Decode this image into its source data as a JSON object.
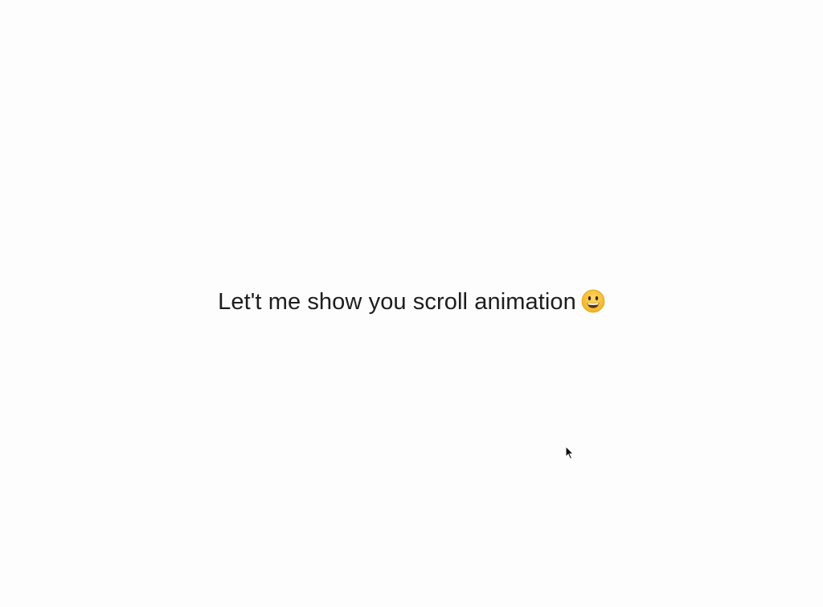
{
  "main": {
    "headline_text": "Let't me show you scroll animation",
    "emoji_icon": "grinning-face-icon"
  },
  "colors": {
    "text": "#1d1d1f",
    "background": "#fdfdfd",
    "emoji_face": "#f7c531"
  }
}
